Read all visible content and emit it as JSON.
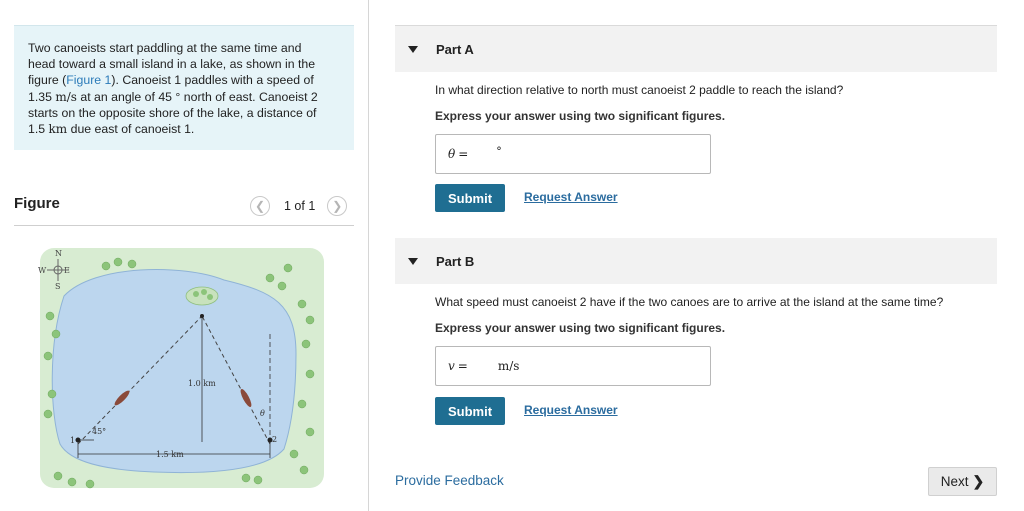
{
  "problem": {
    "line1": "Two canoeists start paddling at the same time and",
    "line2": "head toward a small island in a lake, as shown in the",
    "line3a": "figure (",
    "figure_link": "Figure 1",
    "line3b": "). Canoeist 1 paddles with a speed of",
    "speed_value": "1.35",
    "speed_unit": "m/s",
    "line4b": "at an angle of 45",
    "deg": "°",
    "line4c": "north of east. Canoeist 2",
    "line5": "starts on the opposite shore of the lake, a distance of",
    "dist_value": "1.5",
    "dist_unit": "km",
    "line6b": "due east of canoeist 1."
  },
  "figure": {
    "title": "Figure",
    "pager_text": "1 of 1",
    "compass": {
      "n": "N",
      "s": "S",
      "e": "E",
      "w": "W"
    },
    "label_height": "1.0 km",
    "label_width": "1.5 km",
    "label_angle": "45°",
    "label_theta": "θ",
    "label_c1": "1",
    "label_c2": "2"
  },
  "partA": {
    "header": "Part A",
    "question": "In what direction relative to north must canoeist 2 paddle to reach the island?",
    "instruction": "Express your answer using two significant figures.",
    "variable": "θ",
    "equals": "=",
    "unit": "°",
    "submit": "Submit",
    "request": "Request Answer"
  },
  "partB": {
    "header": "Part B",
    "question": "What speed must canoeist 2 have if the two canoes are to arrive at the island at the same time?",
    "instruction": "Express your answer using two significant figures.",
    "variable": "v",
    "equals": "=",
    "unit": "m/s",
    "submit": "Submit",
    "request": "Request Answer"
  },
  "footer": {
    "feedback": "Provide Feedback",
    "next": "Next"
  },
  "colors": {
    "lake": "#bcd6ee",
    "land": "#d8ecd2",
    "submit": "#1f6e92",
    "link": "#2b6c9f"
  }
}
